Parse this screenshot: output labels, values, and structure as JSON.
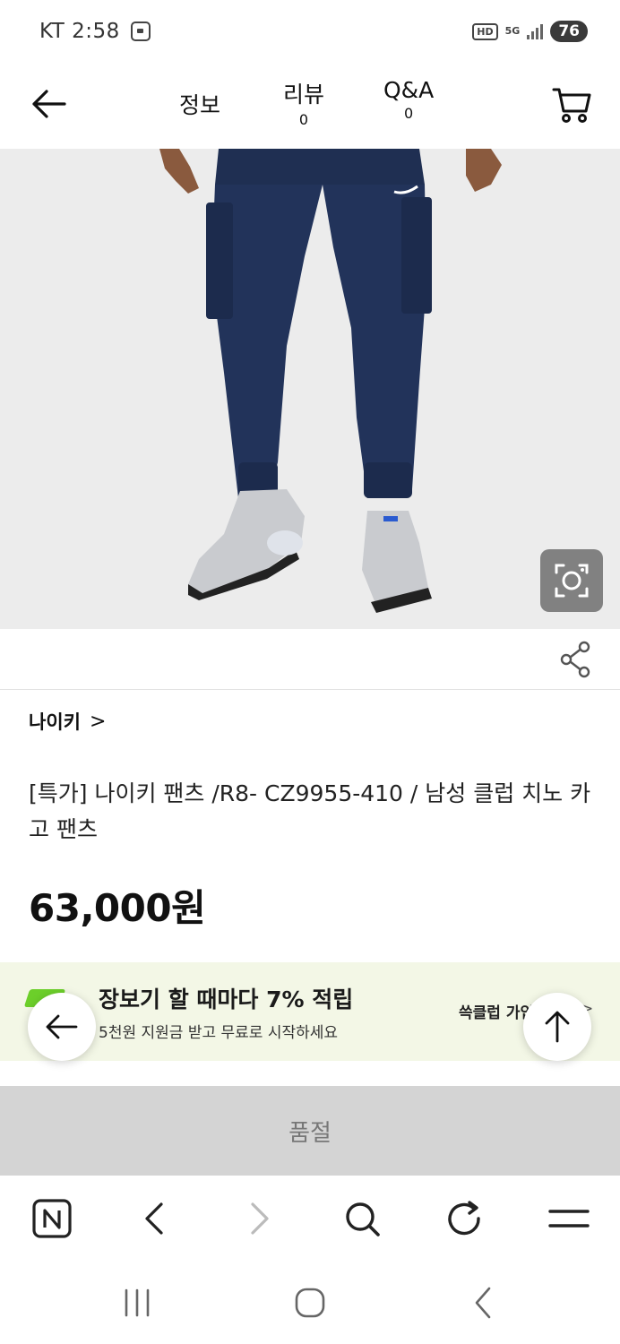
{
  "status_bar": {
    "carrier_time": "KT 2:58",
    "network_hd": "HD",
    "network_5g": "5G",
    "battery": "76"
  },
  "header": {
    "tabs": [
      {
        "label": "정보",
        "count": ""
      },
      {
        "label": "리뷰",
        "count": "0"
      },
      {
        "label": "Q&A",
        "count": "0"
      }
    ]
  },
  "product": {
    "brand": "나이키",
    "brand_chevron": ">",
    "title": "[특가] 나이키 팬츠 /R8- CZ9955-410 / 남성 클럽 치노 카고 팬츠",
    "price": "63,000원"
  },
  "promo": {
    "headline": "장보기 할 때마다 7% 적립",
    "subtext": "5천원 지원금 받고 무료로 시작하세요",
    "join_label": "쓱클럽 가입하기",
    "join_chevron": ">",
    "accent": "#6ccf2a"
  },
  "soldout_label": "품절",
  "icons": {
    "back": "arrow-left-icon",
    "cart": "cart-icon",
    "lens": "camera-lens-icon",
    "share": "share-icon",
    "scroll_top": "arrow-up-icon",
    "naver": "naver-n-icon",
    "browser_back": "chevron-left-icon",
    "browser_forward": "chevron-right-icon",
    "search": "search-icon",
    "reload": "reload-icon",
    "menu": "hamburger-icon",
    "recents": "recents-icon",
    "home": "home-icon",
    "sys_back": "system-back-icon"
  }
}
